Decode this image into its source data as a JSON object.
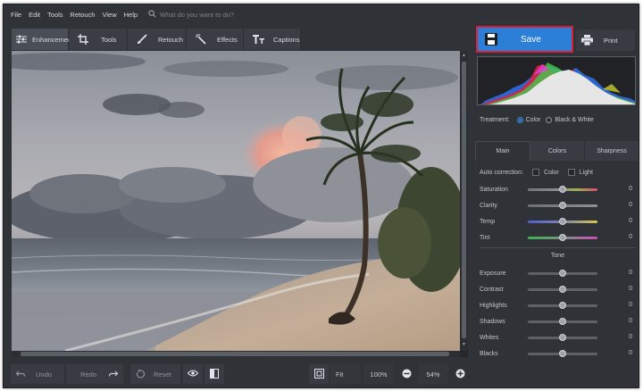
{
  "menu": {
    "items": [
      "File",
      "Edit",
      "Tools",
      "Retouch",
      "View",
      "Help"
    ],
    "search_placeholder": "What do you want to do?"
  },
  "toolbar": {
    "tabs": [
      {
        "label": "Enhancement",
        "icon": "sliders-icon",
        "active": true
      },
      {
        "label": "Tools",
        "icon": "crop-icon",
        "active": false
      },
      {
        "label": "Retouch",
        "icon": "brush-icon",
        "active": false
      },
      {
        "label": "Effects",
        "icon": "magic-wand-icon",
        "active": false
      },
      {
        "label": "Captions",
        "icon": "text-icon",
        "active": false
      }
    ]
  },
  "bottom": {
    "undo_label": "Undo",
    "redo_label": "Redo",
    "reset_label": "Reset",
    "fit_label": "Fit",
    "zoom_100_label": "100%",
    "zoom_value": "54%"
  },
  "panel": {
    "save_label": "Save",
    "print_label": "Print",
    "treatment": {
      "label": "Treatment:",
      "options": [
        "Color",
        "Black & White"
      ],
      "selected": "Color"
    },
    "subtabs": [
      "Main",
      "Colors",
      "Sharpness"
    ],
    "active_subtab": "Main",
    "auto_correction": {
      "label": "Auto correction:",
      "options": [
        "Color",
        "Light"
      ]
    },
    "main_sliders": [
      {
        "label": "Saturation",
        "value": "0",
        "track": "sat"
      },
      {
        "label": "Clarity",
        "value": "0",
        "track": "gray"
      },
      {
        "label": "Temp",
        "value": "0",
        "track": "temp"
      },
      {
        "label": "Tint",
        "value": "0",
        "track": "tint"
      }
    ],
    "tone_heading": "Tone",
    "tone_sliders": [
      {
        "label": "Exposure",
        "value": "0"
      },
      {
        "label": "Contrast",
        "value": "0"
      },
      {
        "label": "Highlights",
        "value": "0"
      },
      {
        "label": "Shadows",
        "value": "0"
      },
      {
        "label": "Whites",
        "value": "0"
      },
      {
        "label": "Blacks",
        "value": "0"
      }
    ]
  },
  "colors": {
    "accent": "#2b7fd6",
    "highlight_border": "#d8203a",
    "panel_bg": "#2f3237"
  }
}
